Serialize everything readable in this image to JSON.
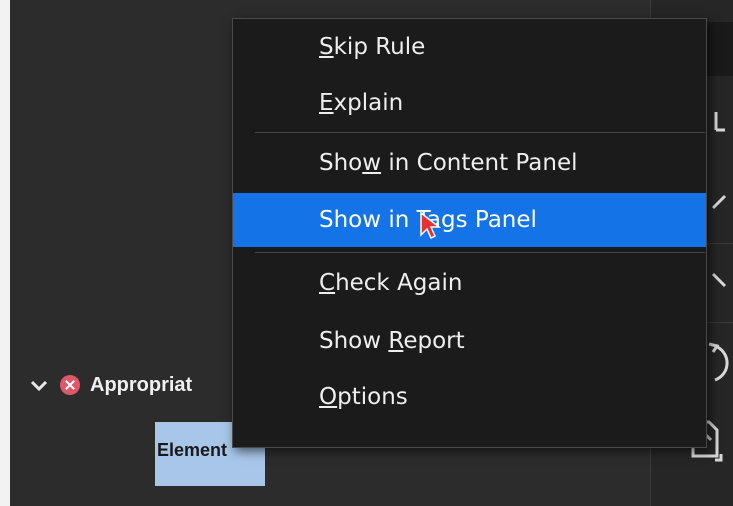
{
  "context_menu": {
    "items": [
      {
        "pre": "",
        "u": "S",
        "post": "kip Rule"
      },
      {
        "pre": "",
        "u": "E",
        "post": "xplain"
      },
      {
        "pre": "Sho",
        "u": "w",
        "post": " in Content Panel"
      },
      {
        "pre": "Show in Tags Panel",
        "u": "",
        "post": ""
      },
      {
        "pre": "",
        "u": "C",
        "post": "heck Again"
      },
      {
        "pre": "Show ",
        "u": "R",
        "post": "eport"
      },
      {
        "pre": "",
        "u": "O",
        "post": "ptions"
      }
    ],
    "highlighted_index": 3
  },
  "tree": {
    "parent_label": "Appropriat",
    "child_label": "Element"
  },
  "colors": {
    "highlight": "#1473e6",
    "error": "#e0566a",
    "selection": "#a7c6e8"
  },
  "icons": {
    "tree_toggle": "chevron-down-icon",
    "status": "error-icon",
    "cursor": "mouse-pointer-icon",
    "toolbar": [
      "toolbar-icon",
      "chevron-up-icon",
      "chevron-down-icon",
      "refresh-icon",
      "export-icon"
    ]
  }
}
